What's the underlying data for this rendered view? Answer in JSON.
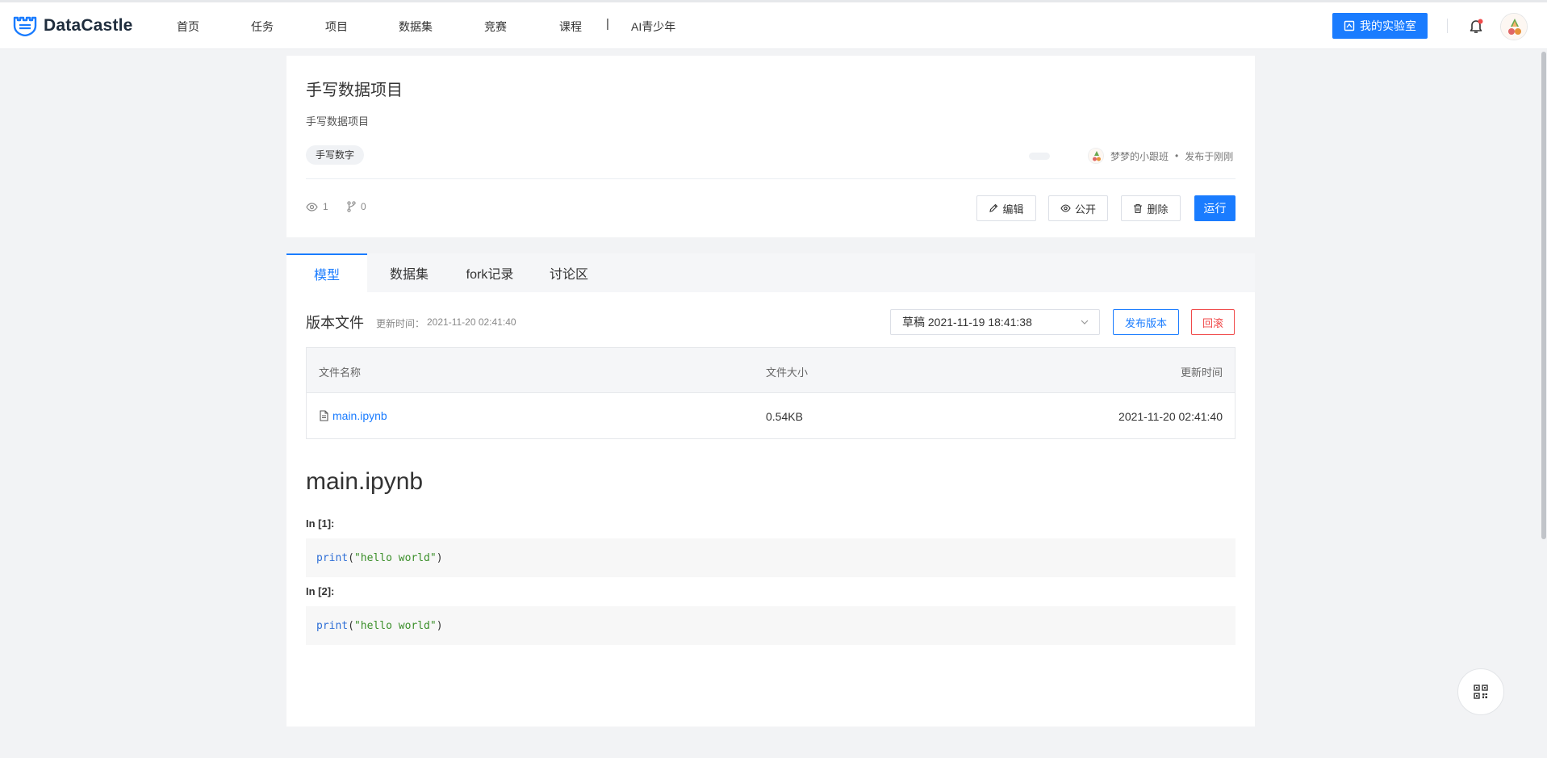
{
  "brand": {
    "name": "DataCastle"
  },
  "nav": {
    "items": [
      {
        "label": "首页"
      },
      {
        "label": "任务"
      },
      {
        "label": "项目"
      },
      {
        "label": "数据集"
      },
      {
        "label": "竞赛"
      },
      {
        "label": "课程"
      },
      {
        "label": "AI青少年"
      }
    ],
    "separator": "|",
    "lab_label": "我的实验室"
  },
  "project": {
    "title": "手写数据项目",
    "description": "手写数据项目",
    "tag": "手写数字",
    "author": "梦梦的小跟班",
    "dot": "•",
    "published": "发布于刚刚",
    "views": "1",
    "forks": "0",
    "actions": {
      "edit": "编辑",
      "public": "公开",
      "delete": "删除",
      "run": "运行"
    }
  },
  "tabs": [
    {
      "label": "模型",
      "active": true
    },
    {
      "label": "数据集",
      "active": false
    },
    {
      "label": "fork记录",
      "active": false
    },
    {
      "label": "讨论区",
      "active": false
    }
  ],
  "versions": {
    "title": "版本文件",
    "update_label": "更新时间：",
    "update_time": "2021-11-20 02:41:40",
    "selected": "草稿 2021-11-19 18:41:38",
    "publish_label": "发布版本",
    "rollback_label": "回滚"
  },
  "files": {
    "headers": {
      "name": "文件名称",
      "size": "文件大小",
      "updated": "更新时间"
    },
    "rows": [
      {
        "name": "main.ipynb",
        "size": "0.54KB",
        "updated": "2021-11-20 02:41:40"
      }
    ]
  },
  "notebook": {
    "title": "main.ipynb",
    "cells": [
      {
        "label": "In [1]:",
        "fn": "print",
        "open": "(",
        "str": "\"hello world\"",
        "close": ")"
      },
      {
        "label": "In [2]:",
        "fn": "print",
        "open": "(",
        "str": "\"hello world\"",
        "close": ")"
      }
    ]
  },
  "colors": {
    "accent": "#1a7cff",
    "danger": "#f04a4a",
    "string": "#3b8f2a"
  }
}
